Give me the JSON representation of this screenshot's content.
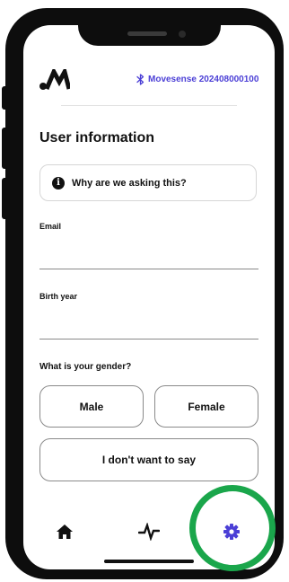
{
  "header": {
    "logo_icon": "movesense-logo-icon",
    "bluetooth_icon": "bluetooth-icon",
    "device_name": "Movesense 202408000100"
  },
  "main": {
    "title": "User information",
    "why_prompt": "Why are we asking this?",
    "info_icon_glyph": "i",
    "email": {
      "label": "Email",
      "value": ""
    },
    "birth_year": {
      "label": "Birth year",
      "value": ""
    },
    "gender": {
      "question": "What is your gender?",
      "options": [
        "Male",
        "Female",
        "I don't want to say"
      ]
    }
  },
  "bottom_nav": {
    "items": [
      {
        "icon": "home-icon"
      },
      {
        "icon": "activity-icon"
      },
      {
        "icon": "gear-icon"
      }
    ]
  },
  "colors": {
    "accent": "#4b3fd6",
    "highlight": "#1aa64b",
    "frame": "#0d0d0d"
  }
}
